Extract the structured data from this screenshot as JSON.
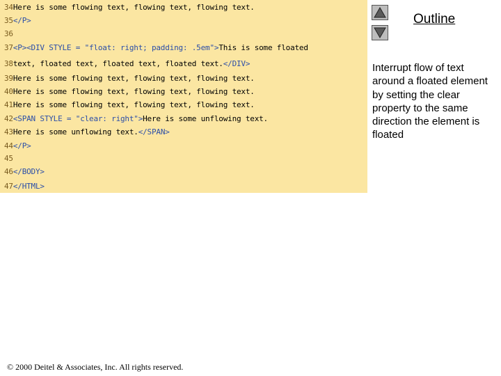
{
  "code": {
    "lines": [
      {
        "num": "34",
        "segments": [
          {
            "text": "Here is some flowing text, flowing text, flowing text.",
            "color": "black"
          }
        ]
      },
      {
        "num": "35",
        "segments": [
          {
            "text": "</P>",
            "color": "blue"
          }
        ]
      },
      {
        "num": "36",
        "segments": []
      },
      {
        "num": "37",
        "segments": [
          {
            "text": "<P><DIV STYLE = \"float: right; padding: .5em\">",
            "color": "blue"
          },
          {
            "text": "This is some floated",
            "color": "black"
          }
        ]
      },
      {
        "num": "38",
        "segments": [
          {
            "text": "text, floated text, floated text, floated text.",
            "color": "black"
          },
          {
            "text": "</DIV>",
            "color": "blue"
          }
        ]
      },
      {
        "num": "39",
        "segments": [
          {
            "text": "Here is some flowing text, flowing text, flowing text.",
            "color": "black"
          }
        ]
      },
      {
        "num": "40",
        "segments": [
          {
            "text": "Here is some flowing text, flowing text, flowing text.",
            "color": "black"
          }
        ]
      },
      {
        "num": "41",
        "segments": [
          {
            "text": "Here is some flowing text, flowing text, flowing text.",
            "color": "black"
          }
        ]
      },
      {
        "num": "42",
        "segments": [
          {
            "text": "<SPAN STYLE = \"clear: right\">",
            "color": "blue"
          },
          {
            "text": "Here is some unflowing text.",
            "color": "black"
          }
        ]
      },
      {
        "num": "43",
        "segments": [
          {
            "text": "Here is some unflowing text.",
            "color": "black"
          },
          {
            "text": "</SPAN>",
            "color": "blue"
          }
        ]
      },
      {
        "num": "44",
        "segments": [
          {
            "text": "</P>",
            "color": "blue"
          }
        ]
      },
      {
        "num": "45",
        "segments": []
      },
      {
        "num": "46",
        "segments": [
          {
            "text": "</BODY>",
            "color": "blue"
          }
        ]
      },
      {
        "num": "47",
        "segments": [
          {
            "text": "</HTML>",
            "color": "blue"
          }
        ]
      }
    ]
  },
  "nav": {
    "prev_icon": "triangle-up-icon",
    "next_icon": "triangle-down-icon",
    "outline_label": "Outline"
  },
  "note": {
    "text": "Interrupt flow of text around a floated element by setting the clear property to the same direction the element is floated"
  },
  "footer": {
    "copyright": "© 2000 Deitel & Associates, Inc. All rights reserved."
  },
  "colors": {
    "panel_background": "#fbe6a2",
    "code_keyword": "#2b4ea8",
    "line_number": "#7a5c1f"
  }
}
